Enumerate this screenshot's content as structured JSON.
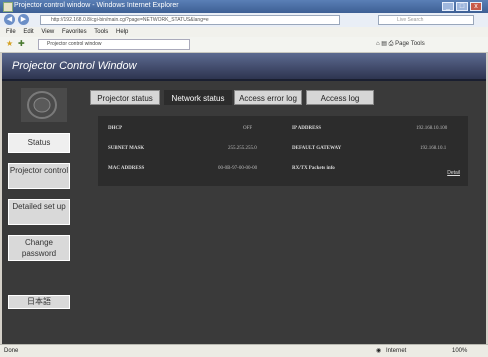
{
  "window": {
    "title": "Projector control window - Windows Internet Explorer"
  },
  "address": {
    "url": "http://192.168.0.8/cgi-bin/main.cgi?page=NETWORK_STATUS&lang=e",
    "search_placeholder": "Live Search"
  },
  "menubar": {
    "items": [
      "File",
      "Edit",
      "View",
      "Favorites",
      "Tools",
      "Help"
    ]
  },
  "tab": {
    "label": "Projector control window"
  },
  "commands": {
    "page": "Page",
    "tools": "Tools"
  },
  "page_title": "Projector Control Window",
  "sidebar": {
    "items": [
      "Status",
      "Projector control",
      "Detailed set up",
      "Change password",
      "日本語"
    ]
  },
  "tabs": [
    "Projector status",
    "Network status",
    "Access error log",
    "Access log"
  ],
  "active_tab_index": 1,
  "network": {
    "rows": [
      {
        "label": "DHCP",
        "value": "OFF"
      },
      {
        "label": "SUBNET MASK",
        "value": "255.255.255.0"
      },
      {
        "label": "MAC ADDRESS",
        "value": "00-0B-97-00-00-00"
      },
      {
        "label": "IP ADDRESS",
        "value": "192.168.10.100"
      },
      {
        "label": "DEFAULT GATEWAY",
        "value": "192.168.10.1"
      },
      {
        "label": "RX/TX Packets info",
        "value": "Detail"
      }
    ]
  },
  "statusbar": {
    "left": "Done",
    "zone": "Internet",
    "zoom": "100%"
  },
  "colors": {
    "page_bg": "#3a3a3a",
    "title_bar": "#3d5f94",
    "active_tab": "#2c2c2c"
  }
}
